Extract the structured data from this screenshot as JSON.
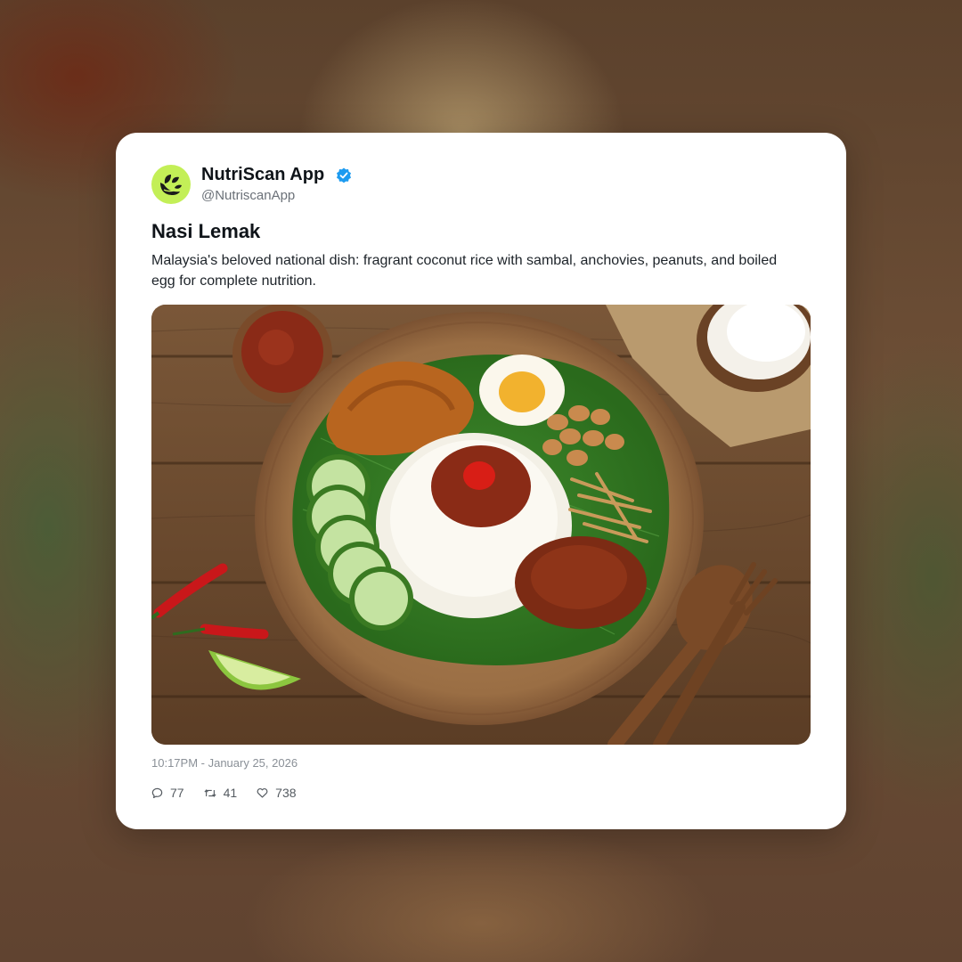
{
  "post": {
    "author_name": "NutriScan App",
    "author_handle": "@NutriscanApp",
    "verified": true,
    "title": "Nasi Lemak",
    "description": "Malaysia's beloved national dish: fragrant coconut rice with sambal, anchovies, peanuts, and boiled egg for complete nutrition.",
    "timestamp": "10:17PM - January 25, 2026",
    "image_subject": "nasi-lemak-plate-photo"
  },
  "stats": {
    "replies": "77",
    "retweets": "41",
    "likes": "738"
  },
  "icons": {
    "avatar": "leaf-logo-icon",
    "verified": "verified-badge-icon",
    "reply": "comment-icon",
    "retweet": "retweet-icon",
    "like": "heart-icon"
  },
  "colors": {
    "avatar_bg": "#c3ef57",
    "verified": "#1d9bf0",
    "card_bg": "#ffffff",
    "text_primary": "#0f1419",
    "text_muted": "#6b7178"
  }
}
